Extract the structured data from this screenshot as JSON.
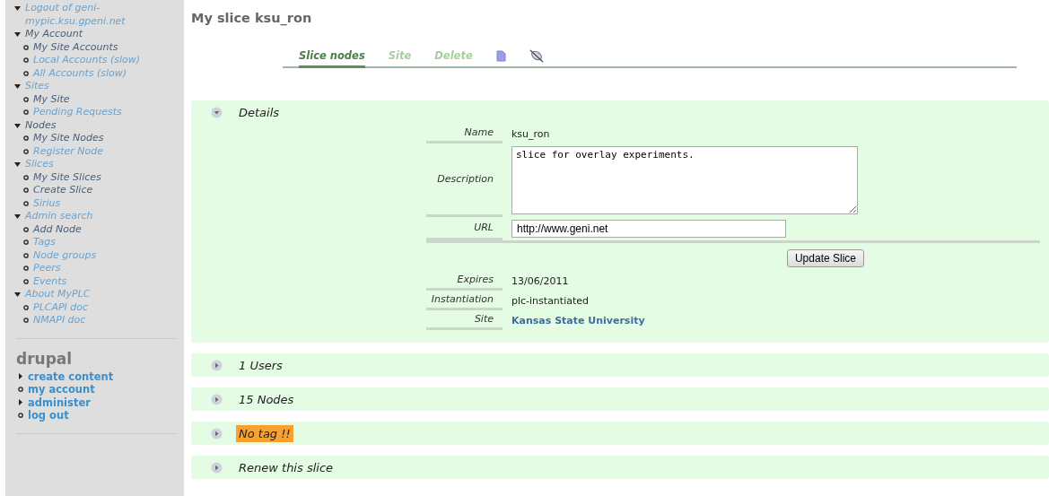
{
  "sidebar": {
    "menu": [
      {
        "label": "Logout of geni-mypic.ksu.gpeni.net",
        "visited": false
      },
      {
        "label": "My Account",
        "visited": true,
        "children": [
          {
            "label": "My Site Accounts",
            "visited": true
          },
          {
            "label": "Local Accounts (slow)",
            "visited": false
          },
          {
            "label": "All Accounts (slow)",
            "visited": false
          }
        ]
      },
      {
        "label": "Sites",
        "visited": false,
        "children": [
          {
            "label": "My Site",
            "visited": true
          },
          {
            "label": "Pending Requests",
            "visited": false
          }
        ]
      },
      {
        "label": "Nodes",
        "visited": true,
        "children": [
          {
            "label": "My Site Nodes",
            "visited": true
          },
          {
            "label": "Register Node",
            "visited": false
          }
        ]
      },
      {
        "label": "Slices",
        "visited": false,
        "children": [
          {
            "label": "My Site Slices",
            "visited": true
          },
          {
            "label": "Create Slice",
            "visited": true
          },
          {
            "label": "Sirius",
            "visited": false
          }
        ]
      },
      {
        "label": "Admin search",
        "visited": false,
        "children": [
          {
            "label": "Add Node",
            "visited": true
          },
          {
            "label": "Tags",
            "visited": false
          },
          {
            "label": "Node groups",
            "visited": false
          },
          {
            "label": "Peers",
            "visited": false
          },
          {
            "label": "Events",
            "visited": false
          }
        ]
      },
      {
        "label": "About MyPLC",
        "visited": false,
        "children": [
          {
            "label": "PLCAPI doc",
            "visited": false
          },
          {
            "label": "NMAPI doc",
            "visited": false
          }
        ]
      }
    ],
    "block_title": "drupal",
    "links": [
      {
        "label": "create content",
        "expandable": true
      },
      {
        "label": "my account",
        "expandable": false
      },
      {
        "label": "administer",
        "expandable": true
      },
      {
        "label": "log out",
        "expandable": false
      }
    ]
  },
  "page_title": "My slice ksu_ron",
  "tabs": [
    {
      "kind": "text",
      "label": "Slice nodes",
      "selected": true
    },
    {
      "kind": "text",
      "label": "Site",
      "selected": false
    },
    {
      "kind": "text",
      "label": "Delete",
      "selected": false
    },
    {
      "kind": "document",
      "selected": false
    },
    {
      "kind": "satellite",
      "selected": false
    }
  ],
  "sections": [
    {
      "title": "Details",
      "expanded": true,
      "warning": false,
      "fields": [
        {
          "kind": "text",
          "label": "Name",
          "value": "ksu_ron"
        },
        {
          "kind": "textarea",
          "label": "Description",
          "value": "slice for overlay experiments."
        },
        {
          "kind": "input",
          "label": "URL",
          "value": "http://www.geni.net"
        },
        {
          "kind": "button",
          "label": "Update Slice"
        },
        {
          "kind": "text",
          "label": "Expires",
          "value": "13/06/2011"
        },
        {
          "kind": "text",
          "label": "Instantiation",
          "value": "plc-instantiated"
        },
        {
          "kind": "link",
          "label": "Site",
          "value": "Kansas State University"
        }
      ]
    },
    {
      "title": "1 Users",
      "expanded": false,
      "warning": false
    },
    {
      "title": "15 Nodes",
      "expanded": false,
      "warning": false
    },
    {
      "title": "No tag !!",
      "expanded": false,
      "warning": true
    },
    {
      "title": "Renew this slice",
      "expanded": false,
      "warning": false
    }
  ]
}
